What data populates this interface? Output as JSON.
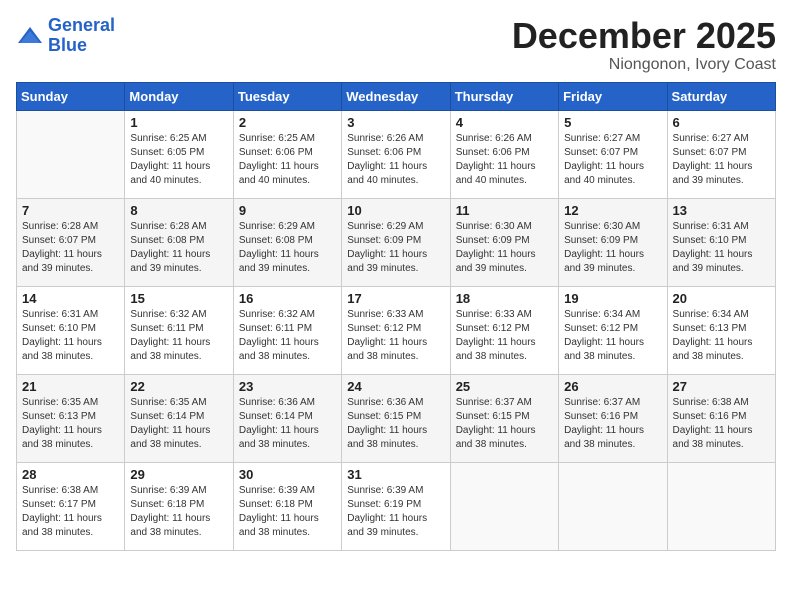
{
  "logo": {
    "line1": "General",
    "line2": "Blue"
  },
  "title": "December 2025",
  "location": "Niongonon, Ivory Coast",
  "weekdays": [
    "Sunday",
    "Monday",
    "Tuesday",
    "Wednesday",
    "Thursday",
    "Friday",
    "Saturday"
  ],
  "weeks": [
    [
      {
        "day": "",
        "sunrise": "",
        "sunset": "",
        "daylight": ""
      },
      {
        "day": "1",
        "sunrise": "Sunrise: 6:25 AM",
        "sunset": "Sunset: 6:05 PM",
        "daylight": "Daylight: 11 hours and 40 minutes."
      },
      {
        "day": "2",
        "sunrise": "Sunrise: 6:25 AM",
        "sunset": "Sunset: 6:06 PM",
        "daylight": "Daylight: 11 hours and 40 minutes."
      },
      {
        "day": "3",
        "sunrise": "Sunrise: 6:26 AM",
        "sunset": "Sunset: 6:06 PM",
        "daylight": "Daylight: 11 hours and 40 minutes."
      },
      {
        "day": "4",
        "sunrise": "Sunrise: 6:26 AM",
        "sunset": "Sunset: 6:06 PM",
        "daylight": "Daylight: 11 hours and 40 minutes."
      },
      {
        "day": "5",
        "sunrise": "Sunrise: 6:27 AM",
        "sunset": "Sunset: 6:07 PM",
        "daylight": "Daylight: 11 hours and 40 minutes."
      },
      {
        "day": "6",
        "sunrise": "Sunrise: 6:27 AM",
        "sunset": "Sunset: 6:07 PM",
        "daylight": "Daylight: 11 hours and 39 minutes."
      }
    ],
    [
      {
        "day": "7",
        "sunrise": "Sunrise: 6:28 AM",
        "sunset": "Sunset: 6:07 PM",
        "daylight": "Daylight: 11 hours and 39 minutes."
      },
      {
        "day": "8",
        "sunrise": "Sunrise: 6:28 AM",
        "sunset": "Sunset: 6:08 PM",
        "daylight": "Daylight: 11 hours and 39 minutes."
      },
      {
        "day": "9",
        "sunrise": "Sunrise: 6:29 AM",
        "sunset": "Sunset: 6:08 PM",
        "daylight": "Daylight: 11 hours and 39 minutes."
      },
      {
        "day": "10",
        "sunrise": "Sunrise: 6:29 AM",
        "sunset": "Sunset: 6:09 PM",
        "daylight": "Daylight: 11 hours and 39 minutes."
      },
      {
        "day": "11",
        "sunrise": "Sunrise: 6:30 AM",
        "sunset": "Sunset: 6:09 PM",
        "daylight": "Daylight: 11 hours and 39 minutes."
      },
      {
        "day": "12",
        "sunrise": "Sunrise: 6:30 AM",
        "sunset": "Sunset: 6:09 PM",
        "daylight": "Daylight: 11 hours and 39 minutes."
      },
      {
        "day": "13",
        "sunrise": "Sunrise: 6:31 AM",
        "sunset": "Sunset: 6:10 PM",
        "daylight": "Daylight: 11 hours and 39 minutes."
      }
    ],
    [
      {
        "day": "14",
        "sunrise": "Sunrise: 6:31 AM",
        "sunset": "Sunset: 6:10 PM",
        "daylight": "Daylight: 11 hours and 38 minutes."
      },
      {
        "day": "15",
        "sunrise": "Sunrise: 6:32 AM",
        "sunset": "Sunset: 6:11 PM",
        "daylight": "Daylight: 11 hours and 38 minutes."
      },
      {
        "day": "16",
        "sunrise": "Sunrise: 6:32 AM",
        "sunset": "Sunset: 6:11 PM",
        "daylight": "Daylight: 11 hours and 38 minutes."
      },
      {
        "day": "17",
        "sunrise": "Sunrise: 6:33 AM",
        "sunset": "Sunset: 6:12 PM",
        "daylight": "Daylight: 11 hours and 38 minutes."
      },
      {
        "day": "18",
        "sunrise": "Sunrise: 6:33 AM",
        "sunset": "Sunset: 6:12 PM",
        "daylight": "Daylight: 11 hours and 38 minutes."
      },
      {
        "day": "19",
        "sunrise": "Sunrise: 6:34 AM",
        "sunset": "Sunset: 6:12 PM",
        "daylight": "Daylight: 11 hours and 38 minutes."
      },
      {
        "day": "20",
        "sunrise": "Sunrise: 6:34 AM",
        "sunset": "Sunset: 6:13 PM",
        "daylight": "Daylight: 11 hours and 38 minutes."
      }
    ],
    [
      {
        "day": "21",
        "sunrise": "Sunrise: 6:35 AM",
        "sunset": "Sunset: 6:13 PM",
        "daylight": "Daylight: 11 hours and 38 minutes."
      },
      {
        "day": "22",
        "sunrise": "Sunrise: 6:35 AM",
        "sunset": "Sunset: 6:14 PM",
        "daylight": "Daylight: 11 hours and 38 minutes."
      },
      {
        "day": "23",
        "sunrise": "Sunrise: 6:36 AM",
        "sunset": "Sunset: 6:14 PM",
        "daylight": "Daylight: 11 hours and 38 minutes."
      },
      {
        "day": "24",
        "sunrise": "Sunrise: 6:36 AM",
        "sunset": "Sunset: 6:15 PM",
        "daylight": "Daylight: 11 hours and 38 minutes."
      },
      {
        "day": "25",
        "sunrise": "Sunrise: 6:37 AM",
        "sunset": "Sunset: 6:15 PM",
        "daylight": "Daylight: 11 hours and 38 minutes."
      },
      {
        "day": "26",
        "sunrise": "Sunrise: 6:37 AM",
        "sunset": "Sunset: 6:16 PM",
        "daylight": "Daylight: 11 hours and 38 minutes."
      },
      {
        "day": "27",
        "sunrise": "Sunrise: 6:38 AM",
        "sunset": "Sunset: 6:16 PM",
        "daylight": "Daylight: 11 hours and 38 minutes."
      }
    ],
    [
      {
        "day": "28",
        "sunrise": "Sunrise: 6:38 AM",
        "sunset": "Sunset: 6:17 PM",
        "daylight": "Daylight: 11 hours and 38 minutes."
      },
      {
        "day": "29",
        "sunrise": "Sunrise: 6:39 AM",
        "sunset": "Sunset: 6:18 PM",
        "daylight": "Daylight: 11 hours and 38 minutes."
      },
      {
        "day": "30",
        "sunrise": "Sunrise: 6:39 AM",
        "sunset": "Sunset: 6:18 PM",
        "daylight": "Daylight: 11 hours and 38 minutes."
      },
      {
        "day": "31",
        "sunrise": "Sunrise: 6:39 AM",
        "sunset": "Sunset: 6:19 PM",
        "daylight": "Daylight: 11 hours and 39 minutes."
      },
      {
        "day": "",
        "sunrise": "",
        "sunset": "",
        "daylight": ""
      },
      {
        "day": "",
        "sunrise": "",
        "sunset": "",
        "daylight": ""
      },
      {
        "day": "",
        "sunrise": "",
        "sunset": "",
        "daylight": ""
      }
    ]
  ]
}
